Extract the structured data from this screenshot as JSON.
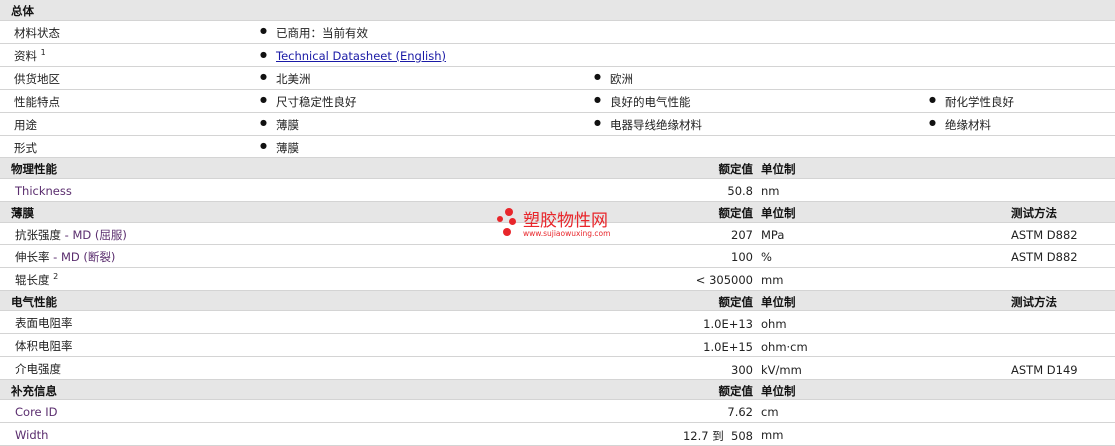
{
  "general": {
    "title": "总体",
    "material_status_label": "材料状态",
    "material_status_value": "已商用：当前有效",
    "docs_label": "资料",
    "docs_sup": "1",
    "docs_link": "Technical Datasheet (English)",
    "region_label": "供货地区",
    "region_1": "北美洲",
    "region_2": "欧洲",
    "features_label": "性能特点",
    "feature_1": "尺寸稳定性良好",
    "feature_2": "良好的电气性能",
    "feature_3": "耐化学性良好",
    "uses_label": "用途",
    "use_1": "薄膜",
    "use_2": "电器导线绝缘材料",
    "use_3": "绝缘材料",
    "form_label": "形式",
    "form_1": "薄膜"
  },
  "physical": {
    "title": "物理性能",
    "nominal": "额定值",
    "unit": "单位制",
    "thickness_label": "Thickness",
    "thickness_value": "50.8",
    "thickness_unit": "nm"
  },
  "film": {
    "title": "薄膜",
    "nominal": "额定值",
    "unit": "单位制",
    "method": "测试方法",
    "tensile_label": "抗张强度",
    "tensile_sub": "- MD (屈服)",
    "tensile_value": "207",
    "tensile_unit": "MPa",
    "tensile_method": "ASTM D882",
    "elong_label": "伸长率",
    "elong_sub": "- MD (断裂)",
    "elong_value": "100",
    "elong_unit": "%",
    "elong_method": "ASTM D882",
    "rolllen_label": "辊长度",
    "rolllen_sup": "2",
    "rolllen_value": "< 305000",
    "rolllen_unit": "mm"
  },
  "electrical": {
    "title": "电气性能",
    "nominal": "额定值",
    "unit": "单位制",
    "method": "测试方法",
    "surf_label": "表面电阻率",
    "surf_value": "1.0E+13",
    "surf_unit": "ohm",
    "vol_label": "体积电阻率",
    "vol_value": "1.0E+15",
    "vol_unit": "ohm·cm",
    "diel_label": "介电强度",
    "diel_value": "300",
    "diel_unit": "kV/mm",
    "diel_method": "ASTM D149"
  },
  "supplement": {
    "title": "补充信息",
    "nominal": "额定值",
    "unit": "单位制",
    "core_label": "Core ID",
    "core_value": "7.62",
    "core_unit": "cm",
    "width_label": "Width",
    "width_value": "12.7 到  508",
    "width_unit": "mm"
  },
  "watermark": {
    "title": "塑胶物性网",
    "url": "www.sujiaowuxing.com",
    "color": "#e8262b"
  }
}
